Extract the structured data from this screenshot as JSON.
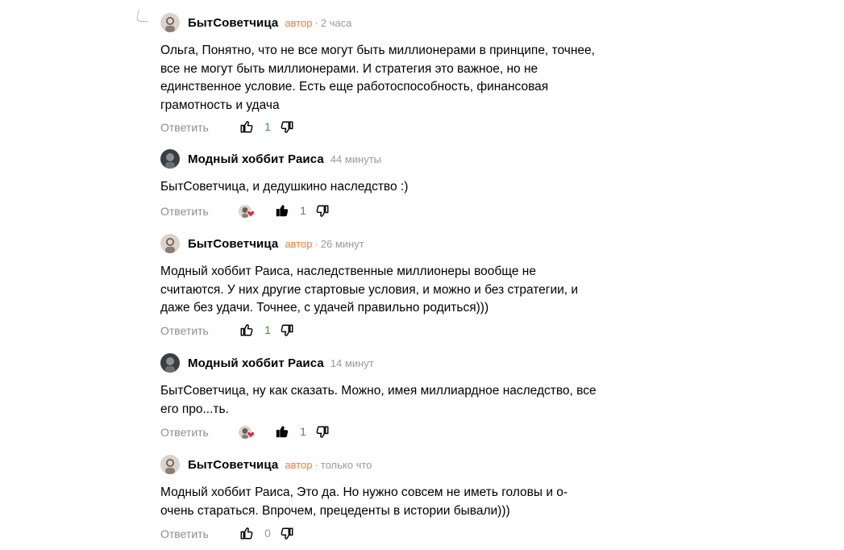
{
  "colors": {
    "author_badge": "#ee7f3b",
    "meta": "#9a9a9a",
    "reply": "#8d8d8d",
    "like_count": "#2f9e3f",
    "zero_count": "#999999"
  },
  "comments": [
    {
      "author": "БытСоветчица",
      "badge": "автор",
      "time": "2 часа",
      "text": "Ольга, Понятно, что не все могут быть миллионерами в принципе, точнее,\nвсе не могут быть миллионерами. И стратегия это важное, но не\nединственное условие. Есть еще работоспособность, финансовая\nграмотность и удача",
      "reply_label": "Ответить",
      "likes": "1",
      "liked": false,
      "has_liker_avatars": false,
      "avatar_icon": "user-avatar-icon"
    },
    {
      "author": "Модный хоббит Раиса",
      "badge": "",
      "time": "44 минуты",
      "text": "БытСоветчица, и дедушкино наследство :)",
      "reply_label": "Ответить",
      "likes": "1",
      "liked": true,
      "has_liker_avatars": true,
      "avatar_icon": "user-avatar-icon"
    },
    {
      "author": "БытСоветчица",
      "badge": "автор",
      "time": "26 минут",
      "text": "Модный хоббит Раиса, наследственные миллионеры вообще не\nсчитаются. У них другие стартовые условия, и можно и без стратегии, и\nдаже без удачи. Точнее, с удачей правильно родиться)))",
      "reply_label": "Ответить",
      "likes": "1",
      "liked": false,
      "has_liker_avatars": false,
      "avatar_icon": "user-avatar-icon"
    },
    {
      "author": "Модный хоббит Раиса",
      "badge": "",
      "time": "14 минут",
      "text": "БытСоветчица, ну как сказать. Можно, имея миллиардное наследство, все\nего про...ть.",
      "reply_label": "Ответить",
      "likes": "1",
      "liked": true,
      "has_liker_avatars": true,
      "avatar_icon": "user-avatar-icon"
    },
    {
      "author": "БытСоветчица",
      "badge": "автор",
      "time": "только что",
      "text": "Модный хоббит Раиса, Это да. Но нужно совсем не иметь головы и о-\nочень стараться. Впрочем, прецеденты в истории бывали)))",
      "reply_label": "Ответить",
      "likes": "0",
      "liked": false,
      "has_liker_avatars": false,
      "avatar_icon": "user-avatar-icon"
    }
  ],
  "icons": {
    "like": "thumbs-up-icon",
    "dislike": "thumbs-down-icon",
    "heart": "heart-icon",
    "thread": "reply-thread-icon"
  }
}
